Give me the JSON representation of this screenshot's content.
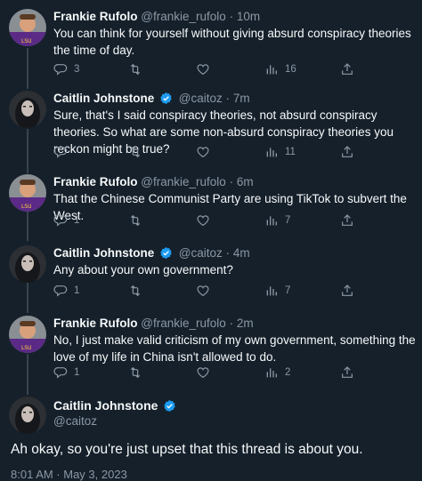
{
  "colors": {
    "background": "#15202b",
    "text_primary": "#f7f9f9",
    "text_secondary": "#8b98a5",
    "verified_blue": "#1d9bf0",
    "thread_line": "#38444d"
  },
  "tweets": [
    {
      "name": "Frankie Rufolo",
      "handle": "@frankie_rufolo",
      "sep": "·",
      "time": "10m",
      "verified": false,
      "text": "You can think for yourself without giving absurd conspiracy theories the time of day.",
      "replies": "3",
      "retweets": "",
      "likes": "",
      "views": "16"
    },
    {
      "name": "Caitlin Johnstone",
      "handle": "@caitoz",
      "sep": "·",
      "time": "7m",
      "verified": true,
      "text": "Sure, that's I said conspiracy theories, not absurd conspiracy theories. So what are some non-absurd conspiracy theories you reckon might be true?",
      "replies": "",
      "retweets": "",
      "likes": "",
      "views": "11"
    },
    {
      "name": "Frankie Rufolo",
      "handle": "@frankie_rufolo",
      "sep": "·",
      "time": "6m",
      "verified": false,
      "text": "That the Chinese Communist Party are using TikTok to subvert the West.",
      "replies": "1",
      "retweets": "",
      "likes": "",
      "views": "7"
    },
    {
      "name": "Caitlin Johnstone",
      "handle": "@caitoz",
      "sep": "·",
      "time": "4m",
      "verified": true,
      "text": "Any about your own government?",
      "replies": "1",
      "retweets": "",
      "likes": "",
      "views": "7"
    },
    {
      "name": "Frankie Rufolo",
      "handle": "@frankie_rufolo",
      "sep": "·",
      "time": "2m",
      "verified": false,
      "text": "No, I just make valid criticism of my own government, something the love of my life in China isn't allowed to do.",
      "replies": "1",
      "retweets": "",
      "likes": "",
      "views": "2"
    }
  ],
  "focus_tweet": {
    "name": "Caitlin Johnstone",
    "handle": "@caitoz",
    "text": "Ah okay, so you're just upset that this thread is about you.",
    "timestamp": "8:01 AM · May 3, 2023"
  }
}
